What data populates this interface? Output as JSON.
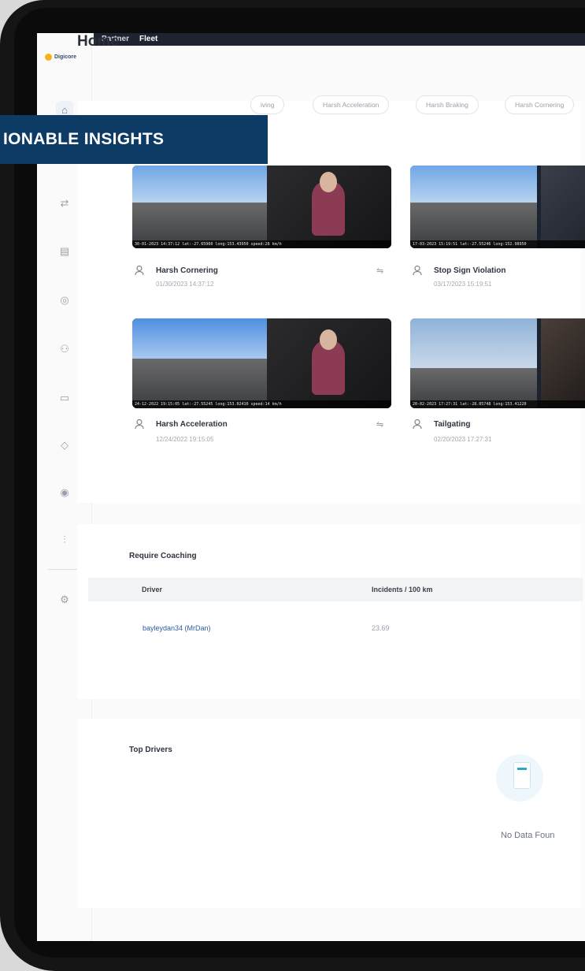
{
  "topbar": {
    "tab_partner": "Partner",
    "tab_fleet": "Fleet"
  },
  "sidebar": {
    "logo_text": "Digicore"
  },
  "page": {
    "title": "Home"
  },
  "banner": {
    "text": "IONABLE INSIGHTS"
  },
  "filters": [
    "Driving",
    "Harsh Acceleration",
    "Harsh Braking",
    "Harsh Cornering"
  ],
  "filters_visible": [
    "iving",
    "Harsh Acceleration",
    "Harsh Braking",
    "Harsh Cornering"
  ],
  "events": [
    {
      "title": "Harsh Cornering",
      "date": "01/30/2023 14:37:12",
      "stamp": "30-01-2023 14:37:12 lat:-27.65960 long:153.43950 speed:28 km/h"
    },
    {
      "title": "Stop Sign Violation",
      "date": "03/17/2023 15:19:51",
      "stamp": "17-03-2023 15:19:51 lat:-27.55246 long:152.98950"
    },
    {
      "title": "Harsh Acceleration",
      "date": "12/24/2022 19:15:05",
      "stamp": "24-12-2022 19:15:05 lat:-27.55245 long:153.02410 speed:14 km/h"
    },
    {
      "title": "Tailgating",
      "date": "02/20/2023 17:27:31",
      "stamp": "20-02-2023 17:27:31 lat:-28.05748 long:153.41220"
    }
  ],
  "coaching": {
    "title": "Require Coaching",
    "col_driver": "Driver",
    "col_incidents": "Incidents / 100 km",
    "rows": [
      {
        "driver": "bayleydan34 (MrDan)",
        "incidents": "23.69"
      }
    ]
  },
  "top_drivers": {
    "title": "Top Drivers",
    "empty_text": "No Data Foun"
  },
  "colors": {
    "banner": "#0e3a66",
    "link": "#2f5b9e",
    "accent": "#f5b21a"
  }
}
